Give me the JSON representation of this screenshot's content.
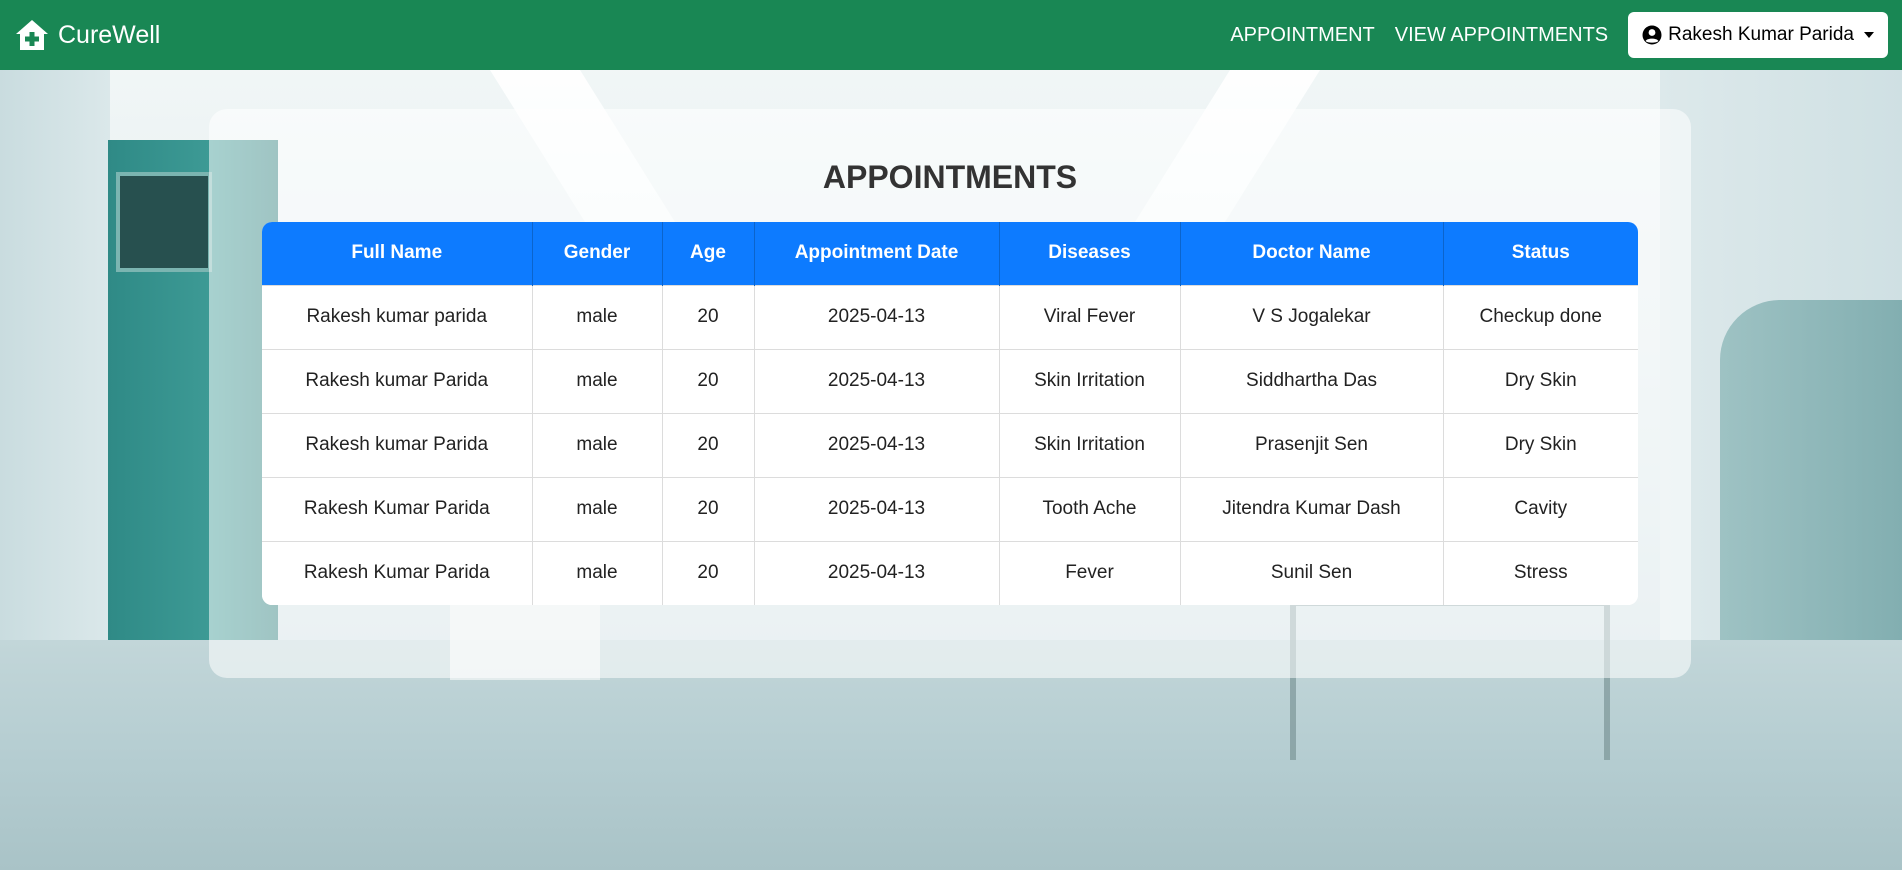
{
  "navbar": {
    "brand": "CureWell",
    "links": [
      "APPOINTMENT",
      "VIEW APPOINTMENTS"
    ],
    "user": "Rakesh Kumar Parida",
    "bg_color": "#198754"
  },
  "panel": {
    "title": "APPOINTMENTS"
  },
  "table": {
    "header_color": "#0d7bff",
    "columns": [
      "Full Name",
      "Gender",
      "Age",
      "Appointment Date",
      "Diseases",
      "Doctor Name",
      "Status"
    ],
    "rows": [
      [
        "Rakesh kumar parida",
        "male",
        "20",
        "2025-04-13",
        "Viral Fever",
        "V S Jogalekar",
        "Checkup done"
      ],
      [
        "Rakesh kumar Parida",
        "male",
        "20",
        "2025-04-13",
        "Skin Irritation",
        "Siddhartha Das",
        "Dry Skin"
      ],
      [
        "Rakesh kumar Parida",
        "male",
        "20",
        "2025-04-13",
        "Skin Irritation",
        "Prasenjit Sen",
        "Dry Skin"
      ],
      [
        "Rakesh Kumar Parida",
        "male",
        "20",
        "2025-04-13",
        "Tooth Ache",
        "Jitendra Kumar Dash",
        "Cavity"
      ],
      [
        "Rakesh Kumar Parida",
        "male",
        "20",
        "2025-04-13",
        "Fever",
        "Sunil Sen",
        "Stress"
      ]
    ]
  }
}
